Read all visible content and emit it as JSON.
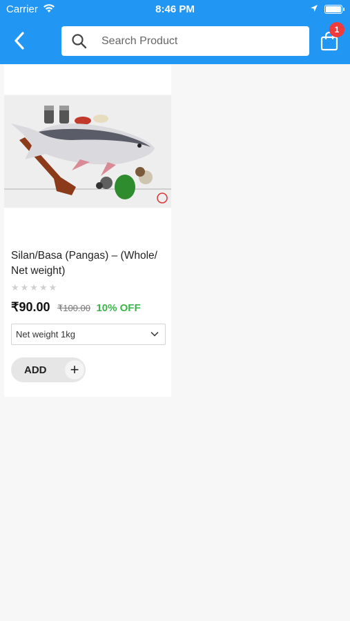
{
  "status_bar": {
    "carrier": "Carrier",
    "time": "8:46 PM"
  },
  "header": {
    "search_placeholder": "Search Product",
    "cart_count": "1",
    "accent_color": "#2196f3"
  },
  "product": {
    "title": "Silan/Basa (Pangas) – (Whole/ Net weight)",
    "rating_stars": "★★★★★",
    "price": "₹90.00",
    "mrp": "₹100.00",
    "discount": "10% OFF",
    "weight_option": "Net weight 1kg",
    "add_label": "ADD",
    "add_plus": "+"
  },
  "icons": [
    "back-chevron-icon",
    "search-icon",
    "cart-bag-icon",
    "wifi-icon",
    "location-arrow-icon",
    "battery-icon",
    "chevron-down-icon",
    "plus-icon"
  ]
}
